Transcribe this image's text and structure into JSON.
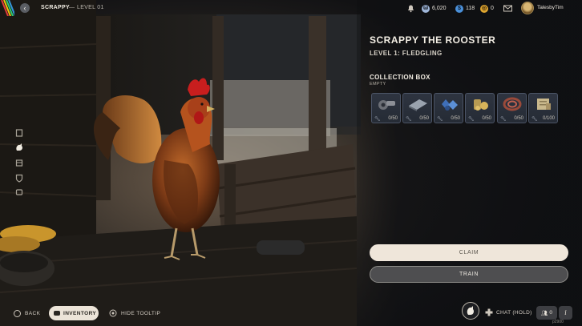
{
  "header": {
    "title": "SCRAPPY",
    "separator": "—",
    "level": "LEVEL 01",
    "currencies": [
      {
        "icon": "coin-stack-icon",
        "value": "6,020",
        "color": "#9fb6d8"
      },
      {
        "icon": "gem-icon",
        "value": "118",
        "color": "#4a90d9"
      },
      {
        "icon": "token-icon",
        "value": "0",
        "color": "#e0a730"
      }
    ],
    "username": "TalesbyTim"
  },
  "rail": {
    "icons": [
      "journal-icon",
      "pet-icon",
      "house-icon",
      "shield-icon",
      "controller-icon"
    ],
    "active": 1
  },
  "panel": {
    "title": "SCRAPPY THE ROOSTER",
    "subtitle": "LEVEL 1: FLEDGLING",
    "box_title": "COLLECTION BOX",
    "box_status": "EMPTY",
    "slots": [
      {
        "item": "gear-parts-item",
        "count": "0/50"
      },
      {
        "item": "sheet-metal-item",
        "count": "0/50"
      },
      {
        "item": "blue-gems-item",
        "count": "0/50"
      },
      {
        "item": "gold-nuggets-item",
        "count": "0/50"
      },
      {
        "item": "copper-wire-item",
        "count": "0/50"
      },
      {
        "item": "scroll-item",
        "count": "0/100"
      }
    ],
    "claim_label": "CLAIM",
    "train_label": "TRAIN"
  },
  "footer": {
    "back_label": "BACK",
    "inventory_label": "INVENTORY",
    "tooltip_label": "HIDE TOOLTIP",
    "chat_label": "CHAT (HOLD)",
    "party_count": "0",
    "info_label": "i",
    "build": "p2900"
  },
  "colors": {
    "claim_bg": "#efe6da",
    "train_bg": "#4e4e50",
    "slot_border": "#4b5466",
    "rooster_comb": "#c81e1e"
  }
}
